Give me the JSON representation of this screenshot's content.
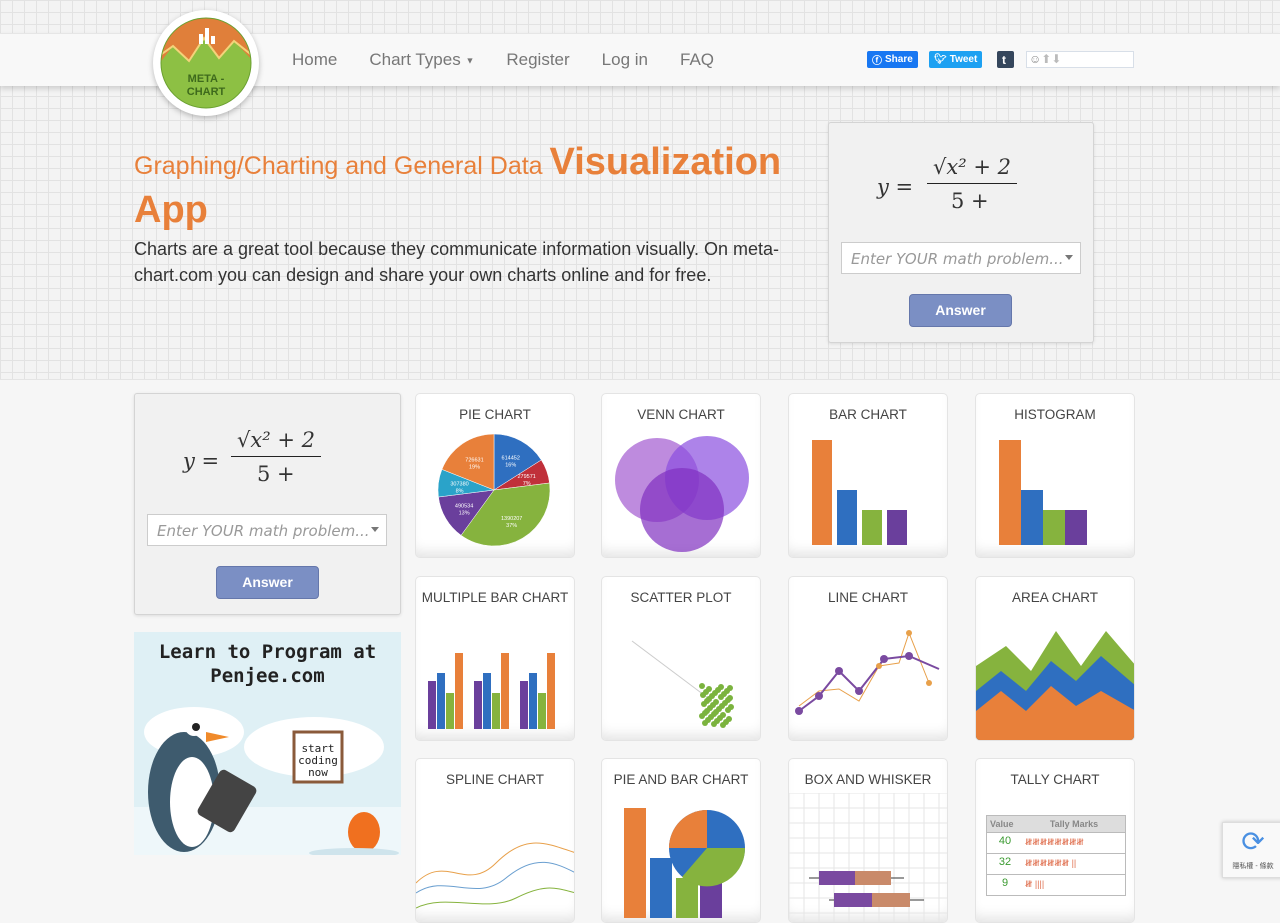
{
  "logo": {
    "text": "META - CHART"
  },
  "nav": {
    "items": [
      "Home",
      "Chart Types",
      "Register",
      "Log in",
      "FAQ"
    ]
  },
  "social": {
    "facebook": "Share",
    "twitter": "Tweet",
    "tumblr": "t"
  },
  "hero": {
    "title_small": "Graphing/Charting and General Data",
    "title_big": "Visualization App",
    "intro": "Charts are a great tool because they communicate information visually. On meta-chart.com you can design and share your own charts online and for free."
  },
  "math": {
    "lhs": "y =",
    "numerator": "√x² + 2",
    "denominator": "5 +",
    "placeholder": "Enter YOUR math problem...",
    "answer": "Answer"
  },
  "banner": {
    "line1": "Learn to Program at",
    "line2": "Penjee.com",
    "sign": "start coding now"
  },
  "cards": [
    "PIE CHART",
    "VENN CHART",
    "BAR CHART",
    "HISTOGRAM",
    "MULTIPLE BAR CHART",
    "SCATTER PLOT",
    "LINE CHART",
    "AREA CHART",
    "SPLINE CHART",
    "PIE AND BAR CHART",
    "BOX AND WHISKER",
    "TALLY CHART"
  ],
  "pie": {
    "slices": [
      {
        "label": "614452",
        "pct": "16%",
        "color": "#2f6fc0"
      },
      {
        "label": "279571",
        "pct": "7%",
        "color": "#c0303a"
      },
      {
        "label": "1390207",
        "pct": "37%",
        "color": "#86b33e"
      },
      {
        "label": "490534",
        "pct": "13%",
        "color": "#6a3f9c"
      },
      {
        "label": "307380",
        "pct": "8%",
        "color": "#2aa3c9"
      },
      {
        "label": "726631",
        "pct": "19%",
        "color": "#e8803a"
      }
    ]
  },
  "tally": {
    "headers": [
      "Value",
      "Tally Marks"
    ],
    "rows": [
      {
        "value": "40",
        "marks": "𝍸𝍸𝍸𝍸𝍸𝍸𝍸𝍸"
      },
      {
        "value": "32",
        "marks": "𝍸𝍸𝍸𝍸𝍸𝍸 ||"
      },
      {
        "value": "9",
        "marks": "𝍸 ||||"
      }
    ]
  },
  "recaptcha": {
    "text": "隱私權 - 條款"
  },
  "colors": {
    "accent": "#e8803a",
    "button": "#7b8fc4"
  }
}
